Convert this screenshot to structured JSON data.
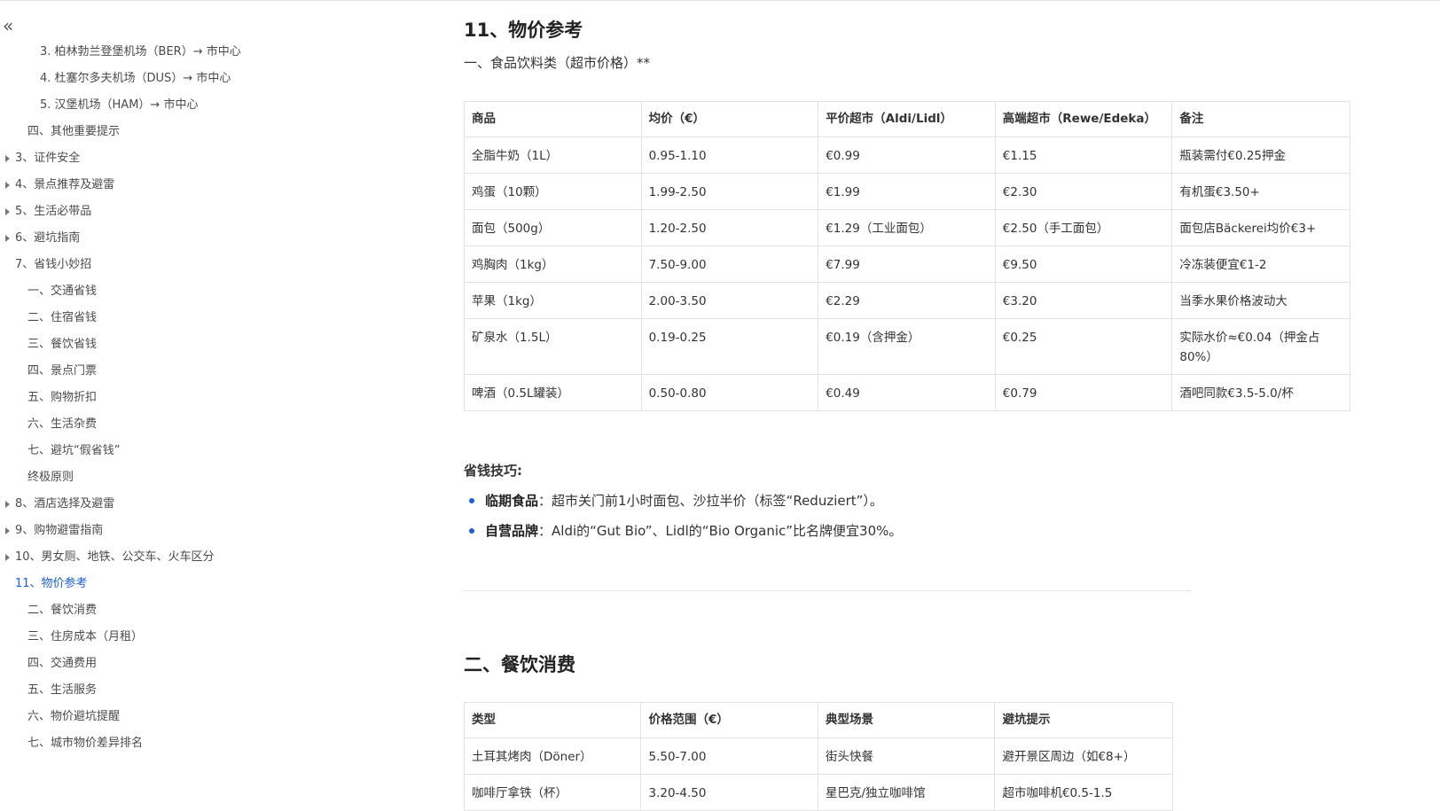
{
  "sidebar": {
    "collapse_icon": "«",
    "toc": [
      {
        "label": "3. 柏林勃兰登堡机场（BER）→ 市中心",
        "level": 3,
        "caret": false,
        "active": false
      },
      {
        "label": "4. 杜塞尔多夫机场（DUS）→ 市中心",
        "level": 3,
        "caret": false,
        "active": false
      },
      {
        "label": "5. 汉堡机场（HAM）→ 市中心",
        "level": 3,
        "caret": false,
        "active": false
      },
      {
        "label": "四、其他重要提示",
        "level": 2,
        "caret": false,
        "active": false
      },
      {
        "label": "3、证件安全",
        "level": 1,
        "caret": true,
        "active": false
      },
      {
        "label": "4、景点推荐及避雷",
        "level": 1,
        "caret": true,
        "active": false
      },
      {
        "label": "5、生活必带品",
        "level": 1,
        "caret": true,
        "active": false
      },
      {
        "label": "6、避坑指南",
        "level": 1,
        "caret": true,
        "active": false
      },
      {
        "label": "7、省钱小妙招",
        "level": 1,
        "caret": false,
        "active": false
      },
      {
        "label": "一、交通省钱",
        "level": 2,
        "caret": false,
        "active": false
      },
      {
        "label": "二、住宿省钱",
        "level": 2,
        "caret": false,
        "active": false
      },
      {
        "label": "三、餐饮省钱",
        "level": 2,
        "caret": false,
        "active": false
      },
      {
        "label": "四、景点门票",
        "level": 2,
        "caret": false,
        "active": false
      },
      {
        "label": "五、购物折扣",
        "level": 2,
        "caret": false,
        "active": false
      },
      {
        "label": "六、生活杂费",
        "level": 2,
        "caret": false,
        "active": false
      },
      {
        "label": "七、避坑“假省钱”",
        "level": 2,
        "caret": false,
        "active": false
      },
      {
        "label": "终极原则",
        "level": 2,
        "caret": false,
        "active": false
      },
      {
        "label": "8、酒店选择及避雷",
        "level": 1,
        "caret": true,
        "active": false
      },
      {
        "label": "9、购物避雷指南",
        "level": 1,
        "caret": true,
        "active": false
      },
      {
        "label": "10、男女厕、地铁、公交车、火车区分",
        "level": 1,
        "caret": true,
        "active": false
      },
      {
        "label": "11、物价参考",
        "level": 1,
        "caret": false,
        "active": true
      },
      {
        "label": "二、餐饮消费",
        "level": 2,
        "caret": false,
        "active": false
      },
      {
        "label": "三、住房成本（月租）",
        "level": 2,
        "caret": false,
        "active": false
      },
      {
        "label": "四、交通费用",
        "level": 2,
        "caret": false,
        "active": false
      },
      {
        "label": "五、生活服务",
        "level": 2,
        "caret": false,
        "active": false
      },
      {
        "label": "六、物价避坑提醒",
        "level": 2,
        "caret": false,
        "active": false
      },
      {
        "label": "七、城市物价差异排名",
        "level": 2,
        "caret": false,
        "active": false
      }
    ]
  },
  "main": {
    "title": "11、物价参考",
    "subtitle": "一、食品饮料类（超市价格）**",
    "price_table": {
      "headers": [
        "商品",
        "均价（€）",
        "平价超市（Aldi/Lidl）",
        "高端超市（Rewe/Edeka）",
        "备注"
      ],
      "rows": [
        [
          "全脂牛奶（1L）",
          "0.95-1.10",
          "€0.99",
          "€1.15",
          "瓶装需付€0.25押金"
        ],
        [
          "鸡蛋（10颗）",
          "1.99-2.50",
          "€1.99",
          "€2.30",
          "有机蛋€3.50+"
        ],
        [
          "面包（500g）",
          "1.20-2.50",
          "€1.29（工业面包）",
          "€2.50（手工面包）",
          "面包店Bäckerei均价€3+"
        ],
        [
          "鸡胸肉（1kg）",
          "7.50-9.00",
          "€7.99",
          "€9.50",
          "冷冻装便宜€1-2"
        ],
        [
          "苹果（1kg）",
          "2.00-3.50",
          "€2.29",
          "€3.20",
          "当季水果价格波动大"
        ],
        [
          "矿泉水（1.5L）",
          "0.19-0.25",
          "€0.19（含押金）",
          "€0.25",
          "实际水价≈€0.04（押金占80%）"
        ],
        [
          "啤酒（0.5L罐装）",
          "0.50-0.80",
          "€0.49",
          "€0.79",
          "酒吧同款€3.5-5.0/杯"
        ]
      ]
    },
    "tips": {
      "heading": "省钱技巧:",
      "items": [
        {
          "bold": "临期食品",
          "text": "：超市关门前1小时面包、沙拉半价（标签“Reduziert”）。"
        },
        {
          "bold": "自营品牌",
          "text": "：Aldi的“Gut Bio”、Lidl的“Bio Organic”比名牌便宜30%。"
        }
      ]
    },
    "section2_title": "二、餐饮消费",
    "food_table": {
      "headers": [
        "类型",
        "价格范围（€）",
        "典型场景",
        "避坑提示"
      ],
      "rows": [
        [
          "土耳其烤肉（Döner）",
          "5.50-7.00",
          "街头快餐",
          "避开景区周边（如€8+）"
        ],
        [
          "咖啡厅拿铁（杯）",
          "3.20-4.50",
          "星巴克/独立咖啡馆",
          "超市咖啡机€0.5-1.5"
        ]
      ]
    }
  },
  "colors": {
    "accent": "#1a5fd6",
    "text": "#333333",
    "border": "#e2e2e2"
  }
}
